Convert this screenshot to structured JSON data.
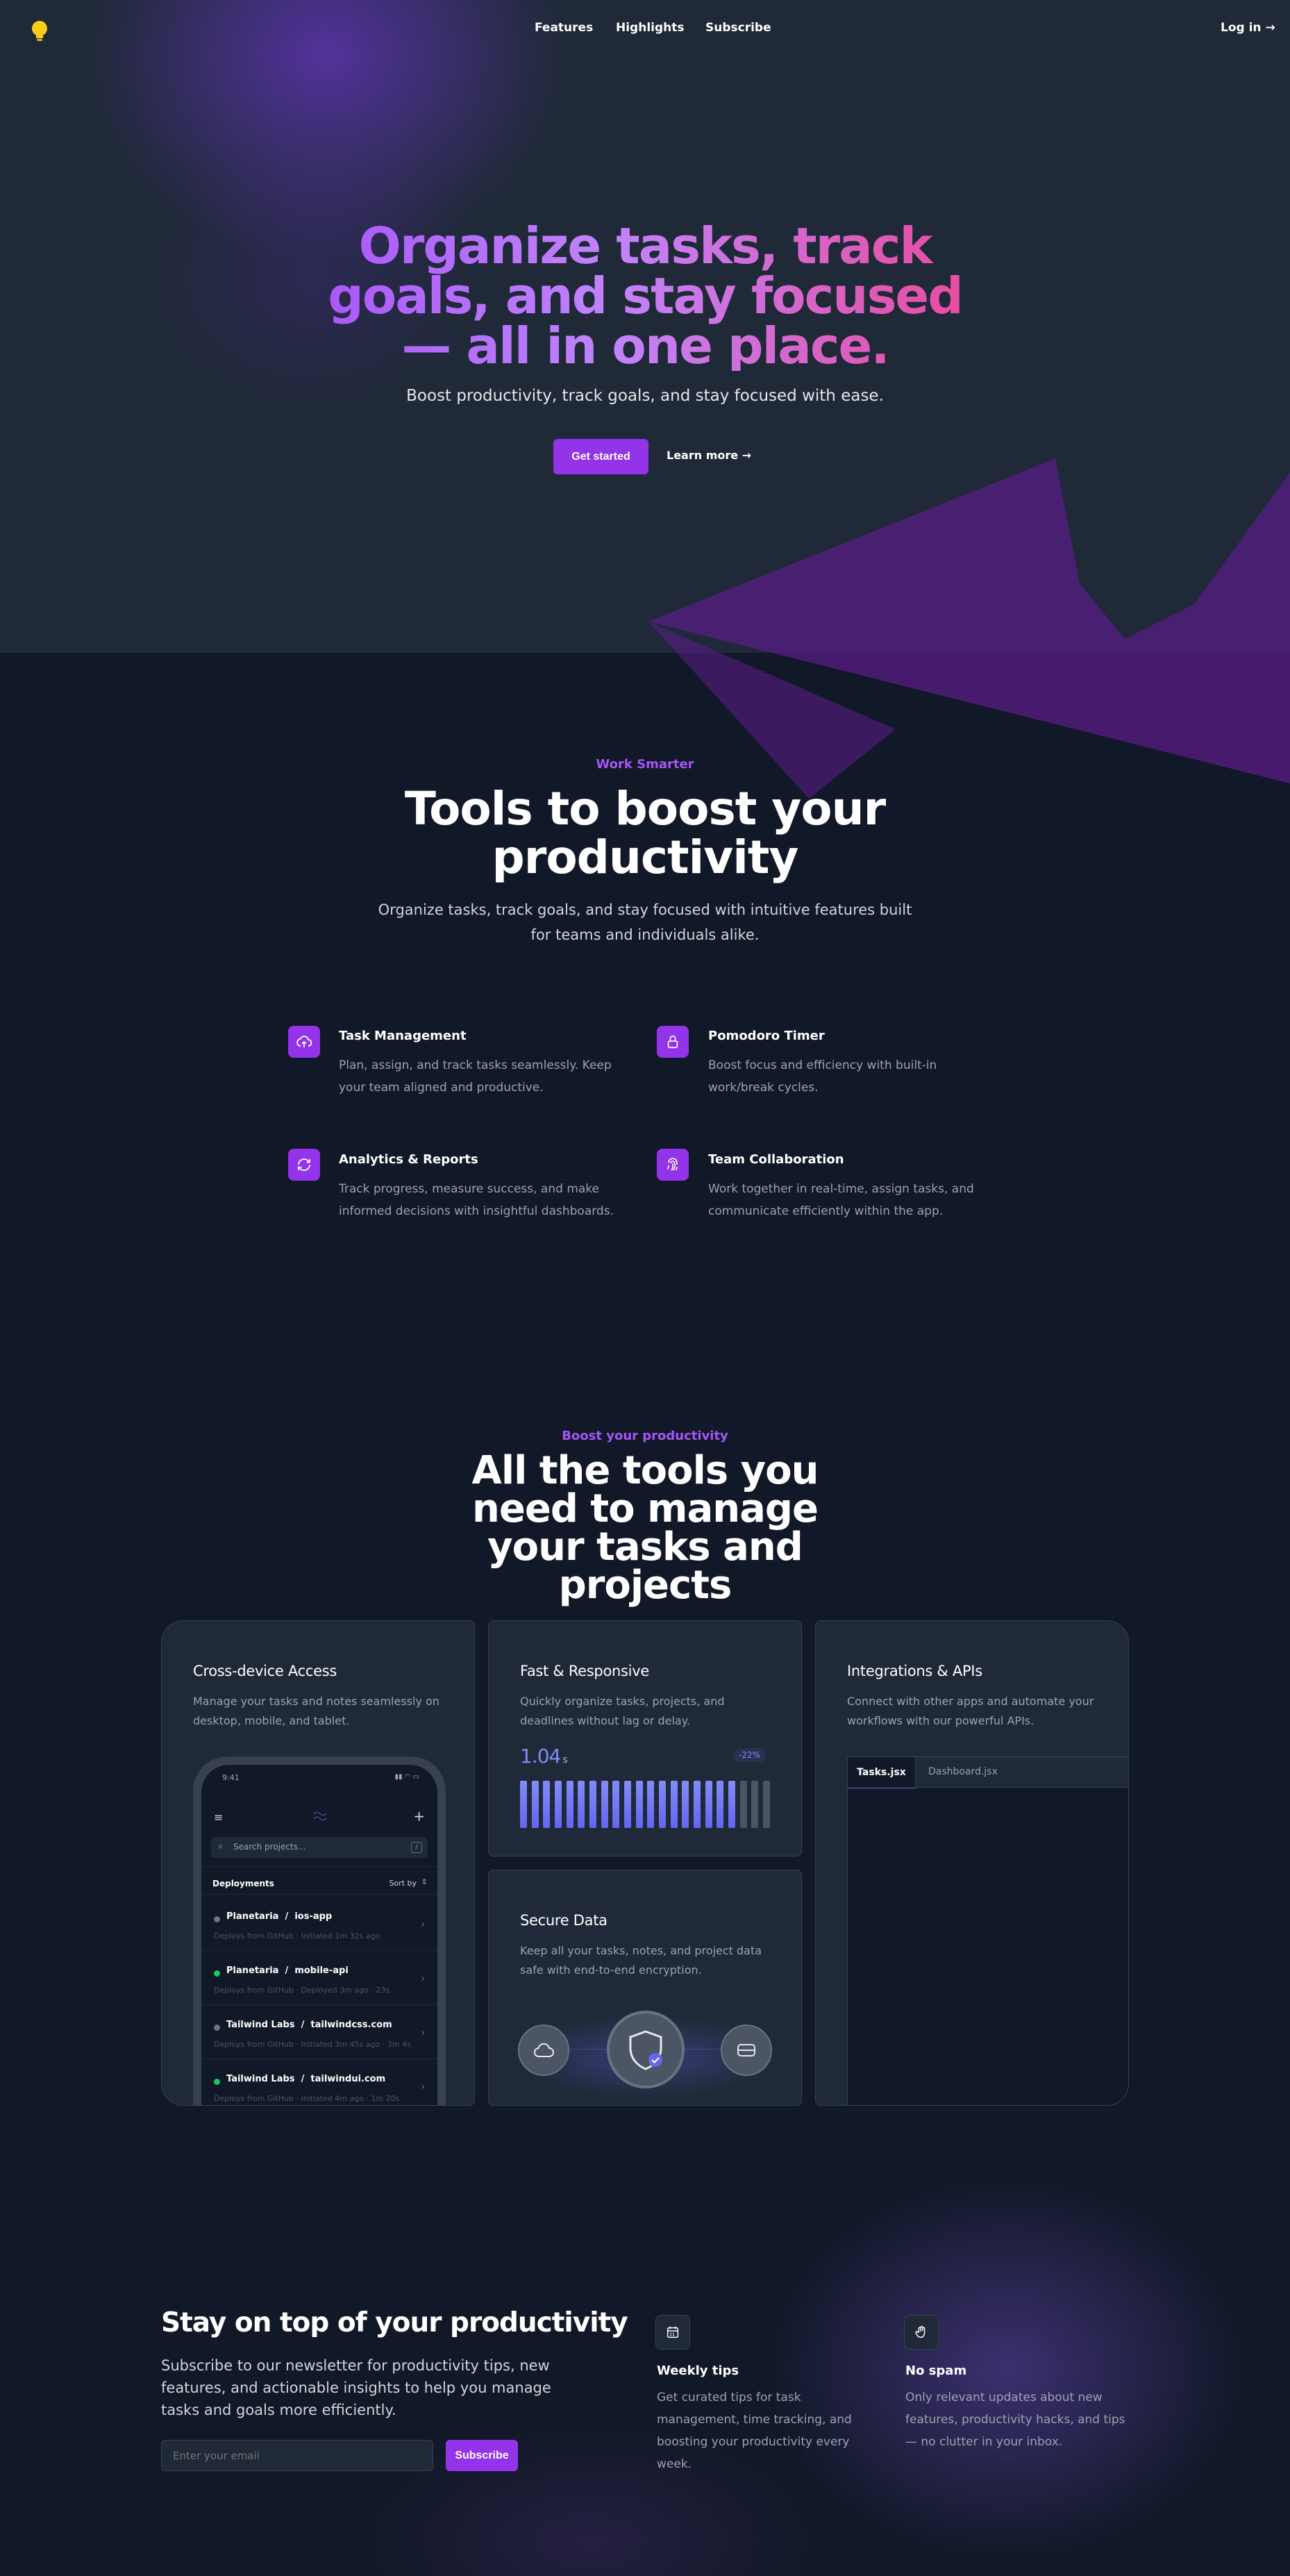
{
  "nav": {
    "logo_icon": "lightbulb-icon",
    "links": [
      "Features",
      "Highlights",
      "Subscribe"
    ],
    "login": "Log in →"
  },
  "hero": {
    "title": "Organize tasks, track goals, and stay focused — all in one place.",
    "subtitle": "Boost productivity, track goals, and stay focused with ease.",
    "primary_cta": "Get started",
    "secondary_cta": "Learn more →"
  },
  "features": {
    "eyebrow": "Work Smarter",
    "title": "Tools to boost your productivity",
    "description": "Organize tasks, track goals, and stay focused with intuitive features built for teams and individuals alike.",
    "items": [
      {
        "icon": "cloud-upload-icon",
        "title": "Task Management",
        "text": "Plan, assign, and track tasks seamlessly. Keep your team aligned and productive."
      },
      {
        "icon": "lock-icon",
        "title": "Pomodoro Timer",
        "text": "Boost focus and efficiency with built-in work/break cycles."
      },
      {
        "icon": "refresh-icon",
        "title": "Analytics & Reports",
        "text": "Track progress, measure success, and make informed decisions with insightful dashboards."
      },
      {
        "icon": "fingerprint-icon",
        "title": "Team Collaboration",
        "text": "Work together in real-time, assign tasks, and communicate efficiently within the app."
      }
    ]
  },
  "bento": {
    "eyebrow": "Boost your productivity",
    "title": "All the tools you need to manage your tasks and projects",
    "cross_device": {
      "title": "Cross-device Access",
      "text": "Manage your tasks and notes seamlessly on desktop, mobile, and tablet.",
      "phone": {
        "time": "9:41",
        "search_placeholder": "Search projects...",
        "list_title": "Deployments",
        "sort_label": "Sort by",
        "rows": [
          {
            "org": "Planetaria",
            "repo": "ios-app",
            "meta": "Deploys from GitHub  ·  Initiated 1m 32s ago",
            "status_color": "#6b7280"
          },
          {
            "org": "Planetaria",
            "repo": "mobile-api",
            "meta": "Deploys from GitHub  ·  Deployed 3m ago  ·  23s",
            "status_color": "#22c55e"
          },
          {
            "org": "Tailwind Labs",
            "repo": "tailwindcss.com",
            "meta": "Deploys from GitHub  ·  Initiated 3m 45s ago  ·  3m 4s",
            "status_color": "#6b7280"
          },
          {
            "org": "Tailwind Labs",
            "repo": "tailwindui.com",
            "meta": "Deploys from GitHub  ·  Initiated 4m ago  ·  1m 20s",
            "status_color": "#22c55e"
          }
        ]
      }
    },
    "fast": {
      "title": "Fast & Responsive",
      "text": "Quickly organize tasks, projects, and deadlines without lag or delay.",
      "metric_value": "1.04",
      "metric_unit": "s",
      "delta": "-22%",
      "bars": {
        "count": 22,
        "active": 19
      }
    },
    "secure": {
      "title": "Secure Data",
      "text": "Keep all your tasks, notes, and project data safe with end-to-end encryption.",
      "icons": [
        "cloud-icon",
        "shield-check-icon",
        "server-icon"
      ]
    },
    "integrations": {
      "title": "Integrations & APIs",
      "text": "Connect with other apps and automate your workflows with our powerful APIs.",
      "tabs": [
        "Tasks.jsx",
        "Dashboard.jsx"
      ]
    }
  },
  "newsletter": {
    "title": "Stay on top of your productivity",
    "text": "Subscribe to our newsletter for productivity tips, new features, and actionable insights to help you manage tasks and goals more efficiently.",
    "input_placeholder": "Enter your email",
    "button": "Subscribe",
    "perks": [
      {
        "icon": "calendar-icon",
        "title": "Weekly tips",
        "text": "Get curated tips for task management, time tracking, and boosting your productivity every week."
      },
      {
        "icon": "hand-icon",
        "title": "No spam",
        "text": "Only relevant updates about new features, productivity hacks, and tips — no clutter in your inbox."
      }
    ]
  },
  "colors": {
    "accent": "#9333ea",
    "accent_light": "#a855f7",
    "pink": "#ec4899",
    "bg": "#111827",
    "hero_bg": "#1f2937"
  }
}
